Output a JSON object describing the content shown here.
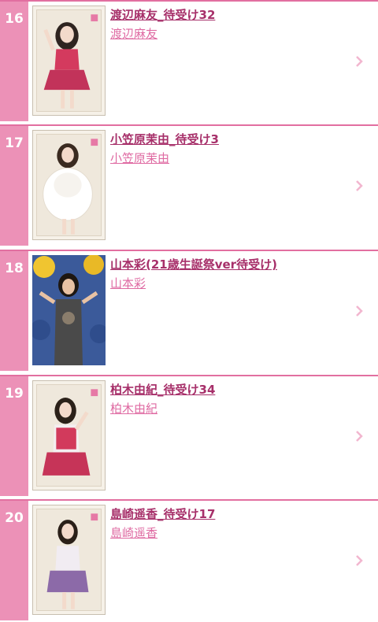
{
  "items": [
    {
      "rank": "16",
      "title": "渡辺麻友_待受け32",
      "name": "渡辺麻友"
    },
    {
      "rank": "17",
      "title": "小笠原茉由_待受け3",
      "name": "小笠原茉由"
    },
    {
      "rank": "18",
      "title": "山本彩(21歳生誕祭ver待受け)",
      "name": "山本彩"
    },
    {
      "rank": "19",
      "title": "柏木由紀_待受け34",
      "name": "柏木由紀"
    },
    {
      "rank": "20",
      "title": "島崎遥香_待受け17",
      "name": "島崎遥香"
    }
  ],
  "colors": {
    "accent": "#ec91b7",
    "title": "#a7306a",
    "subtitle": "#df6aa2",
    "divider": "#e26fa0"
  },
  "icons": {
    "chevron": "chevron-right-icon",
    "thumbnail": "member-photo"
  }
}
